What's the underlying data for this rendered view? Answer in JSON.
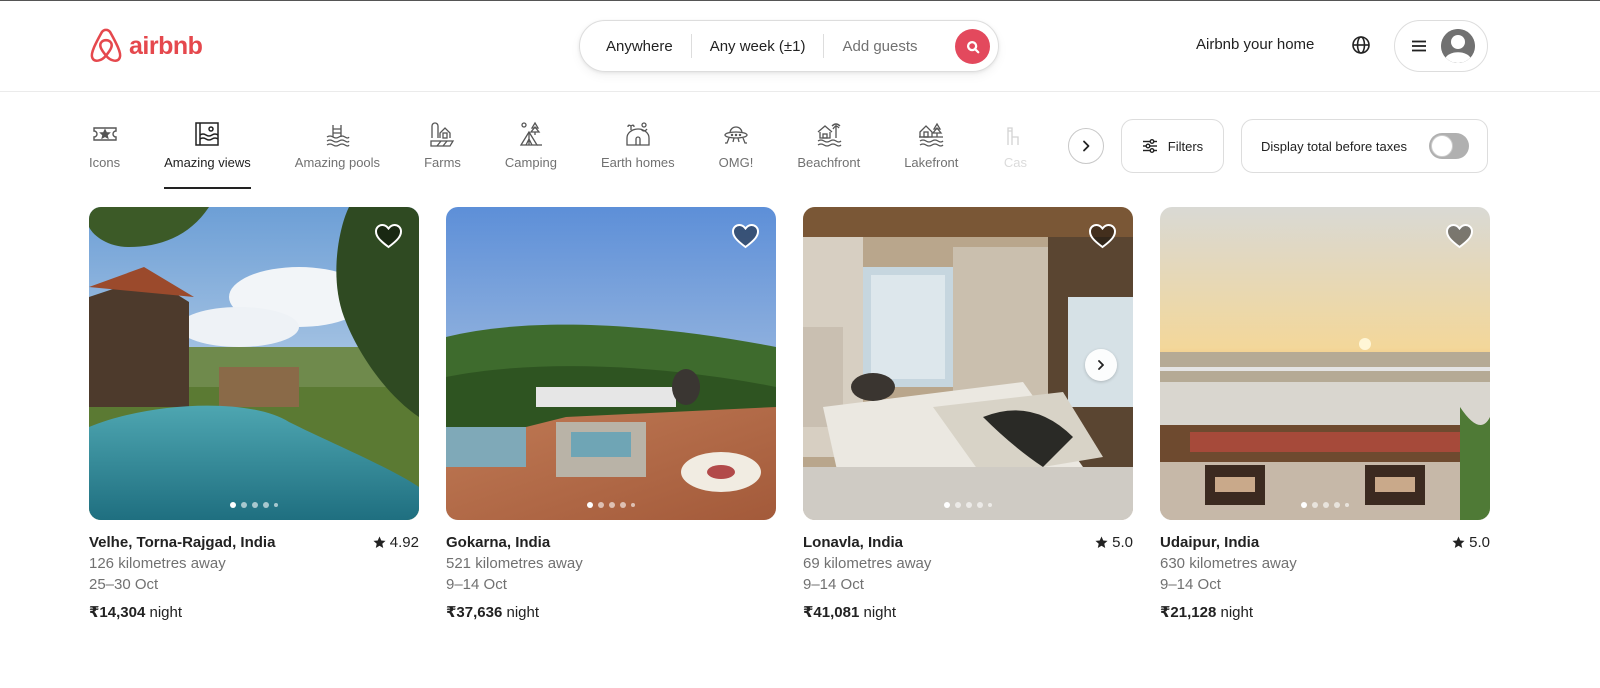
{
  "header": {
    "brand": "airbnb",
    "brand_color": "#e5484d",
    "search": {
      "location": "Anywhere",
      "dates": "Any week (±1)",
      "guests_placeholder": "Add guests",
      "search_icon": "search-icon"
    },
    "host_link": "Airbnb your home",
    "globe_icon": "globe-icon",
    "menu_icon": "hamburger-icon",
    "avatar_icon": "user-avatar-icon"
  },
  "categories": {
    "items": [
      {
        "label": "Icons",
        "icon": "ticket-star-icon",
        "active": false
      },
      {
        "label": "Amazing views",
        "icon": "framed-view-icon",
        "active": true
      },
      {
        "label": "Amazing pools",
        "icon": "pool-icon",
        "active": false
      },
      {
        "label": "Farms",
        "icon": "farm-icon",
        "active": false
      },
      {
        "label": "Camping",
        "icon": "tent-icon",
        "active": false
      },
      {
        "label": "Earth homes",
        "icon": "earth-home-icon",
        "active": false
      },
      {
        "label": "OMG!",
        "icon": "ufo-icon",
        "active": false
      },
      {
        "label": "Beachfront",
        "icon": "beach-hut-icon",
        "active": false
      },
      {
        "label": "Lakefront",
        "icon": "lake-house-icon",
        "active": false
      },
      {
        "label": "Cas",
        "icon": "castle-icon",
        "active": false
      }
    ],
    "next_icon": "chevron-right-icon"
  },
  "filters": {
    "label": "Filters",
    "icon": "sliders-icon"
  },
  "tax_toggle": {
    "label": "Display total before taxes",
    "enabled": false
  },
  "listings": [
    {
      "title": "Velhe, Torna-Rajgad, India",
      "rating": "4.92",
      "distance": "126 kilometres away",
      "dates": "25–30 Oct",
      "price": "₹14,304",
      "price_unit": "night",
      "photo_count": 5,
      "photo_index": 0
    },
    {
      "title": "Gokarna, India",
      "rating": "",
      "distance": "521 kilometres away",
      "dates": "9–14 Oct",
      "price": "₹37,636",
      "price_unit": "night",
      "photo_count": 5,
      "photo_index": 0
    },
    {
      "title": "Lonavla, India",
      "rating": "5.0",
      "distance": "69 kilometres away",
      "dates": "9–14 Oct",
      "price": "₹41,081",
      "price_unit": "night",
      "photo_count": 5,
      "photo_index": 0
    },
    {
      "title": "Udaipur, India",
      "rating": "5.0",
      "distance": "630 kilometres away",
      "dates": "9–14 Oct",
      "price": "₹21,128",
      "price_unit": "night",
      "photo_count": 5,
      "photo_index": 0
    }
  ]
}
